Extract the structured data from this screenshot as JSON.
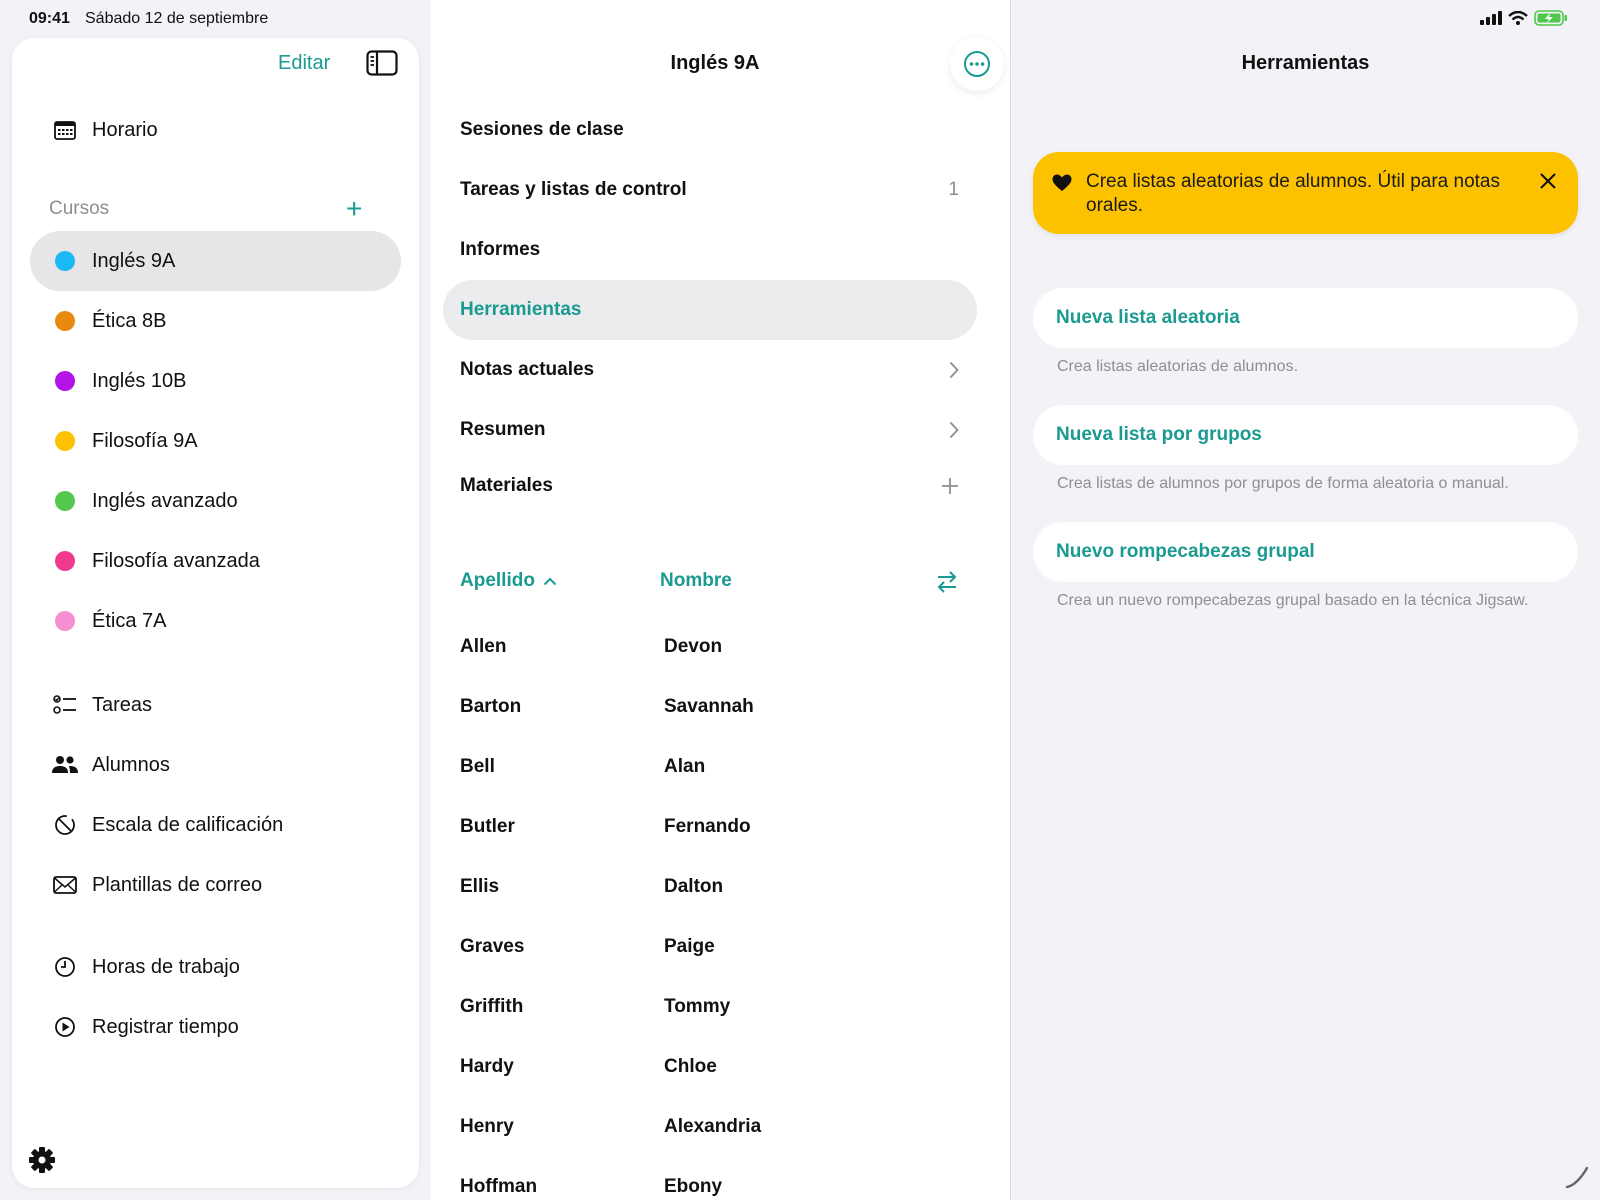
{
  "status": {
    "time": "09:41",
    "date": "Sábado 12 de septiembre"
  },
  "sidebar": {
    "edit_label": "Editar",
    "schedule_label": "Horario",
    "courses_title": "Cursos",
    "courses": [
      {
        "label": "Inglés 9A",
        "color": "#1cb8f5"
      },
      {
        "label": "Ética 8B",
        "color": "#e88a10"
      },
      {
        "label": "Inglés 10B",
        "color": "#b512e8"
      },
      {
        "label": "Filosofía 9A",
        "color": "#fcc200"
      },
      {
        "label": "Inglés avanzado",
        "color": "#55c94f"
      },
      {
        "label": "Filosofía avanzada",
        "color": "#f03a8e"
      },
      {
        "label": "Ética 7A",
        "color": "#f58fd2"
      }
    ],
    "links": [
      {
        "label": "Tareas",
        "icon": "checklist-icon"
      },
      {
        "label": "Alumnos",
        "icon": "people-icon"
      },
      {
        "label": "Escala de calificación",
        "icon": "grading-scale-icon"
      },
      {
        "label": "Plantillas de correo",
        "icon": "envelope-icon"
      }
    ],
    "time_links": [
      {
        "label": "Horas de trabajo",
        "icon": "clock-icon"
      },
      {
        "label": "Registrar tiempo",
        "icon": "play-circle-icon"
      }
    ]
  },
  "course": {
    "title": "Inglés 9A",
    "menu": [
      {
        "label": "Sesiones de clase"
      },
      {
        "label": "Tareas y listas de control",
        "count": "1"
      },
      {
        "label": "Informes"
      },
      {
        "label": "Herramientas"
      },
      {
        "label": "Notas actuales"
      },
      {
        "label": "Resumen"
      },
      {
        "label": "Materiales"
      }
    ],
    "columns": {
      "last": "Apellido",
      "first": "Nombre"
    },
    "students": [
      {
        "last": "Allen",
        "first": "Devon"
      },
      {
        "last": "Barton",
        "first": "Savannah"
      },
      {
        "last": "Bell",
        "first": "Alan"
      },
      {
        "last": "Butler",
        "first": "Fernando"
      },
      {
        "last": "Ellis",
        "first": "Dalton"
      },
      {
        "last": "Graves",
        "first": "Paige"
      },
      {
        "last": "Griffith",
        "first": "Tommy"
      },
      {
        "last": "Hardy",
        "first": "Chloe"
      },
      {
        "last": "Henry",
        "first": "Alexandria"
      },
      {
        "last": "Hoffman",
        "first": "Ebony"
      }
    ]
  },
  "tools": {
    "title": "Herramientas",
    "banner": "Crea listas aleatorias de alumnos. Útil para notas orales.",
    "items": [
      {
        "label": "Nueva lista aleatoria",
        "desc": "Crea listas aleatorias de alumnos."
      },
      {
        "label": "Nueva lista por grupos",
        "desc": "Crea listas de alumnos por grupos de forma aleatoria o manual."
      },
      {
        "label": "Nuevo rompecabezas grupal",
        "desc": "Crea un nuevo rompecabezas grupal basado en la técnica Jigsaw."
      }
    ]
  },
  "colors": {
    "accent": "#1a9a90",
    "banner": "#fcc200"
  }
}
